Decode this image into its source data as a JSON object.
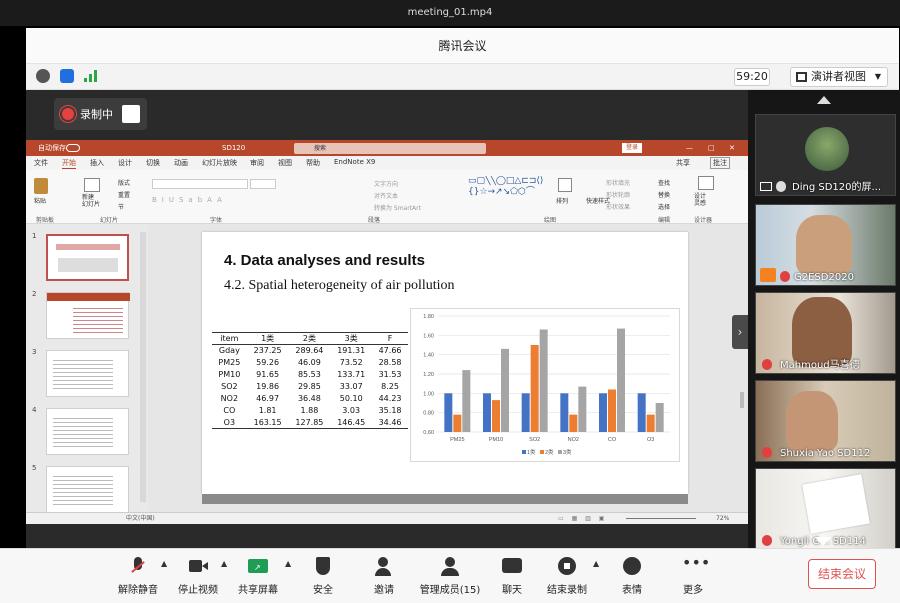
{
  "window": {
    "file_title": "meeting_01.mp4",
    "app_title": "腾讯会议"
  },
  "topbar": {
    "timer": "59:20",
    "view_label": "演讲者视图"
  },
  "recording": {
    "label": "录制中"
  },
  "ppt": {
    "window_title": "SD120",
    "autosave": "自动保存",
    "search_placeholder": "搜索",
    "login": "登录",
    "tabs": [
      "文件",
      "开始",
      "插入",
      "设计",
      "切换",
      "动画",
      "幻灯片放映",
      "审阅",
      "视图",
      "帮助",
      "EndNote X9"
    ],
    "share_label": "共享",
    "comment_label": "批注",
    "groups": [
      "剪贴板",
      "幻灯片",
      "字体",
      "段落",
      "绘图",
      "编辑",
      "设计器"
    ],
    "ribbon_items": {
      "paste": "粘贴",
      "new_slide": "新建\n幻灯片",
      "layout": "版式",
      "reset": "重置",
      "section": "节",
      "find": "查找",
      "replace": "替换",
      "select": "选择",
      "design_ideas": "设计\n灵感",
      "fill": "形状填充",
      "outline": "形状轮廓",
      "effect": "形状效果",
      "arrange": "排列",
      "quick_styles": "快速样式",
      "text_dir": "文字方向",
      "align_text": "对齐文本",
      "smartart": "转换为 SmartArt"
    },
    "thumbnail_numbers": [
      "1",
      "2",
      "3",
      "4",
      "5"
    ],
    "status_lang": "中文(中国)",
    "zoom": "72%"
  },
  "slide": {
    "heading": "4. Data analyses and results",
    "subheading": "4.2. Spatial heterogeneity of air pollution",
    "table_header": [
      "item",
      "1类",
      "2类",
      "3类",
      "F"
    ],
    "table_rows": [
      [
        "Gday",
        "237.25",
        "289.64",
        "191.31",
        "47.66"
      ],
      [
        "PM25",
        "59.26",
        "46.09",
        "73.52",
        "28.58"
      ],
      [
        "PM10",
        "91.65",
        "85.53",
        "133.71",
        "31.53"
      ],
      [
        "SO2",
        "19.86",
        "29.85",
        "33.07",
        "8.25"
      ],
      [
        "NO2",
        "46.97",
        "36.48",
        "50.10",
        "44.23"
      ],
      [
        "CO",
        "1.81",
        "1.88",
        "3.03",
        "35.18"
      ],
      [
        "O3",
        "163.15",
        "127.85",
        "146.45",
        "34.46"
      ]
    ]
  },
  "chart_data": {
    "type": "bar",
    "categories": [
      "PM25",
      "PM10",
      "SO2",
      "NO2",
      "CO",
      "O3"
    ],
    "series": [
      {
        "name": "1类",
        "values": [
          1.0,
          1.0,
          1.0,
          1.0,
          1.0,
          1.0
        ]
      },
      {
        "name": "2类",
        "values": [
          0.78,
          0.93,
          1.5,
          0.78,
          1.04,
          0.78
        ]
      },
      {
        "name": "3类",
        "values": [
          1.24,
          1.46,
          1.66,
          1.07,
          1.67,
          0.9
        ]
      }
    ],
    "ylim": [
      0.6,
      1.8
    ],
    "yticks": [
      "0.60",
      "0.80",
      "1.00",
      "1.20",
      "1.40",
      "1.60",
      "1.80"
    ],
    "colors": [
      "#4472c4",
      "#ed7d31",
      "#a5a5a5"
    ],
    "grid": true,
    "legend": "bottom"
  },
  "participants": [
    {
      "name": "Ding SD120的屏..."
    },
    {
      "name": "G2ESD2020"
    },
    {
      "name": "Mahmoud马喜德"
    },
    {
      "name": "Shuxia Yao SD112"
    },
    {
      "name": "Yongli G... SD114"
    }
  ],
  "bottombar": {
    "unmute": "解除静音",
    "stop_video": "停止视频",
    "share_screen": "共享屏幕",
    "security": "安全",
    "invite": "邀请",
    "manage": "管理成员(15)",
    "chat": "聊天",
    "end_record": "结束录制",
    "reactions": "表情",
    "more": "更多",
    "end_meeting": "结束会议"
  }
}
